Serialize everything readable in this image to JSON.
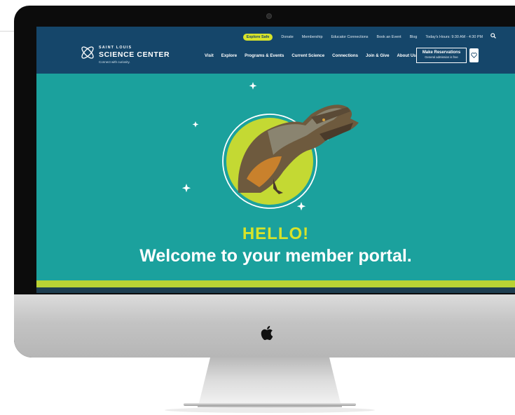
{
  "colors": {
    "teal": "#1ba19d",
    "navy": "#15466a",
    "lime": "#d7e32a",
    "green_band": "#b9d234"
  },
  "utility_nav": {
    "explore_safe": "Explore Safe",
    "donate": "Donate",
    "membership": "Membership",
    "educator": "Educator Connections",
    "book_event": "Book an Event",
    "blog": "Blog",
    "hours": "Today's Hours: 9:30 AM - 4:30 PM",
    "search_icon": "search-icon"
  },
  "brand": {
    "line1": "SAINT LOUIS",
    "line2": "SCIENCE CENTER",
    "tagline": "Connect with curiosity."
  },
  "main_nav": [
    "Visit",
    "Explore",
    "Programs & Events",
    "Current Science",
    "Connections",
    "Join & Give",
    "About Us"
  ],
  "reserve": {
    "title": "Make Reservations",
    "subtitle": "General admission is free"
  },
  "heart_icon": "heart-icon",
  "hero": {
    "hello": "HELLO!",
    "welcome": "Welcome to your member portal."
  }
}
